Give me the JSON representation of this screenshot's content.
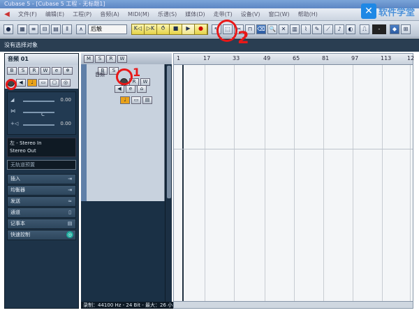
{
  "window": {
    "title": "Cubase 5 - [Cubase 5 工程 - 无标题1]"
  },
  "brand": {
    "logo_text": "软件学堂"
  },
  "menu": [
    "文件(F)",
    "编辑(E)",
    "工程(P)",
    "音频(A)",
    "MIDI(M)",
    "乐谱(S)",
    "媒体(D)",
    "走带(T)",
    "设备(V)",
    "窗口(W)",
    "帮助(H)"
  ],
  "toolbar": {
    "mode_select": "后触",
    "transport": {
      "rewind": "K◁",
      "forward": "▷K",
      "cycle": "⥀",
      "stop": "■",
      "play": "▶",
      "record": "●"
    },
    "small_select": "-"
  },
  "status": {
    "message": "没有选择对象"
  },
  "inspector": {
    "track_name": "音频 01",
    "volume_value": "0.00",
    "pan_label": "C",
    "pan_value": "0.00",
    "input_routing": "左 - Stereo In",
    "output_routing": "Stereo Out",
    "search_placeholder": "无轨道预置",
    "sections": [
      "插入",
      "均衡器",
      "发送",
      "通道",
      "记事本",
      "快速控制"
    ]
  },
  "track_list": {
    "track_name": "音频"
  },
  "project_info": {
    "text": "录制：44100 Hz - 24 Bit - 最大：26 小"
  },
  "ruler": {
    "ticks": [
      "1",
      "17",
      "33",
      "49",
      "65",
      "81",
      "97",
      "113",
      "12"
    ]
  },
  "annotations": {
    "label_1": "1",
    "label_2": "2"
  },
  "colors": {
    "accent_red": "#e81818",
    "transport_yellow": "#f3e36b",
    "inspector_bg": "#1d3348",
    "logo_blue": "#1e88e5"
  }
}
